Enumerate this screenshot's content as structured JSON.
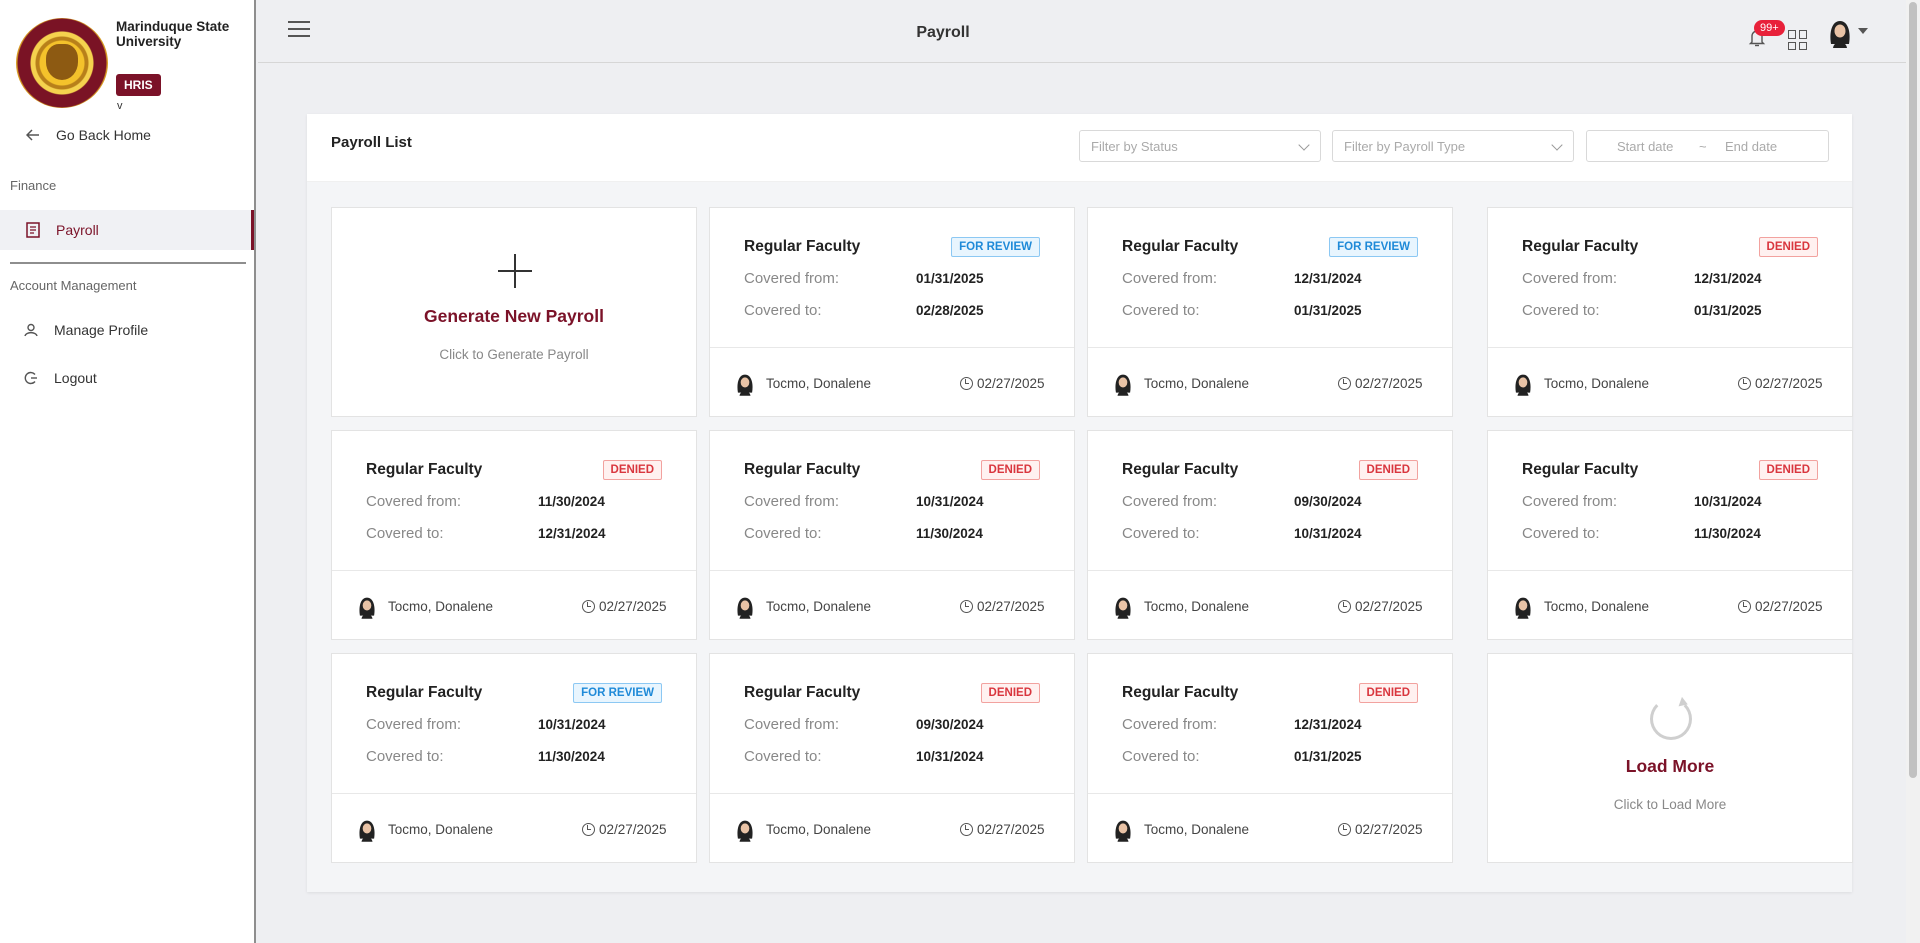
{
  "brand": {
    "name": "Marinduque State University",
    "app": "HRIS",
    "version": "v"
  },
  "sidebar": {
    "back_label": "Go Back Home",
    "section_finance": "Finance",
    "payroll_label": "Payroll",
    "section_account": "Account Management",
    "profile_label": "Manage Profile",
    "logout_label": "Logout"
  },
  "header": {
    "title": "Payroll",
    "notification_count": "99+"
  },
  "panel": {
    "title": "Payroll List",
    "status_placeholder": "Filter by Status",
    "type_placeholder": "Filter by Payroll Type",
    "start_placeholder": "Start date",
    "range_sep": "~",
    "end_placeholder": "End date"
  },
  "generate": {
    "title": "Generate New Payroll",
    "subtitle": "Click to Generate Payroll"
  },
  "load_more": {
    "title": "Load More",
    "subtitle": "Click to Load More"
  },
  "labels": {
    "from": "Covered from:",
    "to": "Covered to:"
  },
  "status_colors": {
    "FOR REVIEW": "#1f8ad8",
    "DENIED": "#d9363e"
  },
  "cards": [
    {
      "title": "Regular Faculty",
      "status": "FOR REVIEW",
      "from": "01/31/2025",
      "to": "02/28/2025",
      "user": "Tocmo, Donalene",
      "date": "02/27/2025"
    },
    {
      "title": "Regular Faculty",
      "status": "FOR REVIEW",
      "from": "12/31/2024",
      "to": "01/31/2025",
      "user": "Tocmo, Donalene",
      "date": "02/27/2025"
    },
    {
      "title": "Regular Faculty",
      "status": "DENIED",
      "from": "12/31/2024",
      "to": "01/31/2025",
      "user": "Tocmo, Donalene",
      "date": "02/27/2025"
    },
    {
      "title": "Regular Faculty",
      "status": "DENIED",
      "from": "11/30/2024",
      "to": "12/31/2024",
      "user": "Tocmo, Donalene",
      "date": "02/27/2025"
    },
    {
      "title": "Regular Faculty",
      "status": "DENIED",
      "from": "10/31/2024",
      "to": "11/30/2024",
      "user": "Tocmo, Donalene",
      "date": "02/27/2025"
    },
    {
      "title": "Regular Faculty",
      "status": "DENIED",
      "from": "09/30/2024",
      "to": "10/31/2024",
      "user": "Tocmo, Donalene",
      "date": "02/27/2025"
    },
    {
      "title": "Regular Faculty",
      "status": "DENIED",
      "from": "10/31/2024",
      "to": "11/30/2024",
      "user": "Tocmo, Donalene",
      "date": "02/27/2025"
    },
    {
      "title": "Regular Faculty",
      "status": "FOR REVIEW",
      "from": "10/31/2024",
      "to": "11/30/2024",
      "user": "Tocmo, Donalene",
      "date": "02/27/2025"
    },
    {
      "title": "Regular Faculty",
      "status": "DENIED",
      "from": "09/30/2024",
      "to": "10/31/2024",
      "user": "Tocmo, Donalene",
      "date": "02/27/2025"
    },
    {
      "title": "Regular Faculty",
      "status": "DENIED",
      "from": "12/31/2024",
      "to": "01/31/2025",
      "user": "Tocmo, Donalene",
      "date": "02/27/2025"
    }
  ]
}
